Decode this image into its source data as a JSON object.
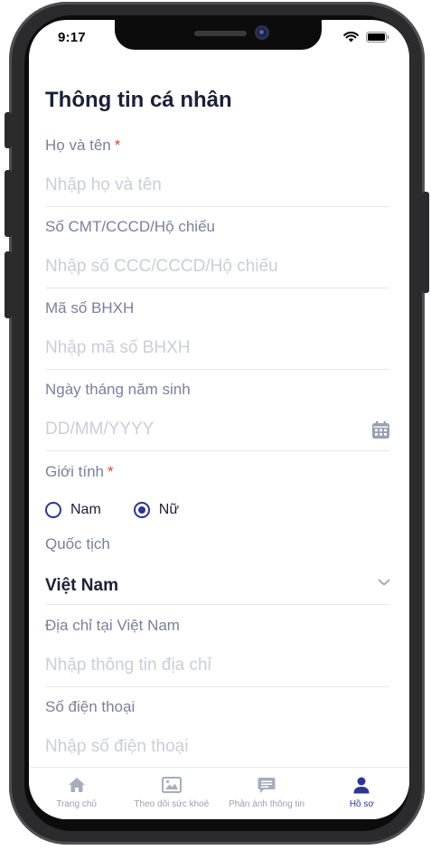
{
  "status_bar": {
    "time": "9:17"
  },
  "page": {
    "title": "Thông tin cá nhân"
  },
  "fields": {
    "full_name": {
      "label": "Họ và tên",
      "required_mark": "*",
      "placeholder": "Nhập họ và tên",
      "value": ""
    },
    "id_number": {
      "label": "Số CMT/CCCD/Hộ chiếu",
      "placeholder": "Nhập số CCC/CCCD/Hộ chiếu",
      "value": ""
    },
    "social_insurance": {
      "label": "Mã số BHXH",
      "placeholder": "Nhập mã số BHXH",
      "value": ""
    },
    "birth_date": {
      "label": "Ngày tháng năm sinh",
      "placeholder": "DD/MM/YYYY",
      "value": ""
    },
    "gender": {
      "label": "Giới tính",
      "required_mark": "*",
      "options": [
        "Nam",
        "Nữ"
      ],
      "selected": "Nữ"
    },
    "nationality": {
      "label": "Quốc tịch",
      "value": "Việt Nam"
    },
    "address": {
      "label": "Địa chỉ tại Việt Nam",
      "placeholder": "Nhập thông tin địa chỉ",
      "value": ""
    },
    "phone": {
      "label": "Số điện thoại",
      "placeholder": "Nhập số điện thoại",
      "value": ""
    }
  },
  "bottom_nav": {
    "items": [
      {
        "label": "Trang chủ",
        "icon": "home-icon"
      },
      {
        "label": "Theo dõi sức khoẻ",
        "icon": "picture-icon"
      },
      {
        "label": "Phản ánh thông tin",
        "icon": "message-icon"
      },
      {
        "label": "Hồ sơ",
        "icon": "user-icon"
      }
    ],
    "active_index": 3
  },
  "colors": {
    "accent": "#2e3590",
    "required": "#d9463f",
    "label": "#7a819b",
    "placeholder": "#cbced8",
    "text": "#1c2036"
  }
}
